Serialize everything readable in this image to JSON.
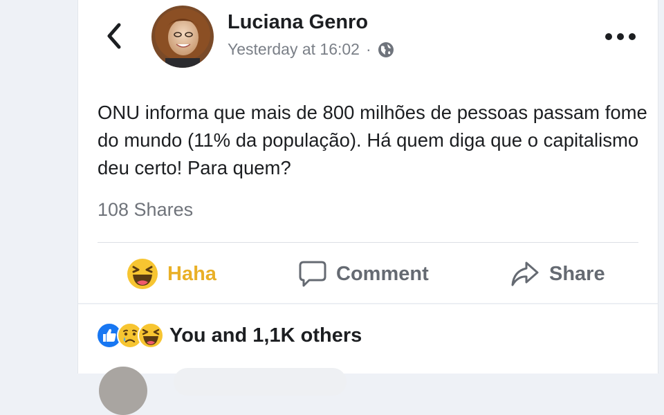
{
  "post": {
    "author": "Luciana Genro",
    "timestamp": "Yesterday at 16:02",
    "separator": "·",
    "privacy_icon": "globe-icon",
    "text": "ONU informa que mais de 800 milhões de pessoas passam fome do mundo (11% da população). Há quem diga que o capitalismo deu certo! Para quem?",
    "shares": "108 Shares"
  },
  "header": {
    "back_icon": "chevron-left-icon",
    "more_icon": "more-horizontal-icon"
  },
  "actions": {
    "haha_label": "Haha",
    "comment_label": "Comment",
    "share_label": "Share"
  },
  "reactions": {
    "icons": [
      "like-icon",
      "sad-icon",
      "haha-icon"
    ],
    "summary": "You and 1,1K others"
  },
  "colors": {
    "haha_active": "#E9B027",
    "like_blue": "#1877F2",
    "text_primary": "#1C1E21",
    "text_secondary": "#7A7F87",
    "page_background": "#EEF1F6"
  }
}
